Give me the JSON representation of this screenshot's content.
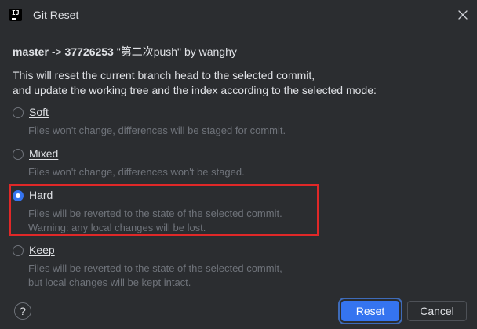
{
  "window": {
    "title": "Git Reset",
    "app_icon": "jetbrains-ide-icon"
  },
  "subject": {
    "branch": "master",
    "arrow": "->",
    "hash": "37726253",
    "message": "\"第二次push\"",
    "by": "by wanghy"
  },
  "description": {
    "line1": "This will reset the current branch head to the selected commit,",
    "line2": "and update the working tree and the index according to the selected mode:"
  },
  "options": [
    {
      "label": "Soft",
      "checked": false,
      "hint1": "Files won't change, differences will be staged for commit.",
      "hint2": ""
    },
    {
      "label": "Mixed",
      "checked": false,
      "hint1": "Files won't change, differences won't be staged.",
      "hint2": ""
    },
    {
      "label": "Hard",
      "checked": true,
      "hint1": "Files will be reverted to the state of the selected commit.",
      "hint2": "Warning: any local changes will be lost."
    },
    {
      "label": "Keep",
      "checked": false,
      "hint1": "Files will be reverted to the state of the selected commit,",
      "hint2": "but local changes will be kept intact."
    }
  ],
  "buttons": {
    "help": "?",
    "reset": "Reset",
    "cancel": "Cancel"
  },
  "colors": {
    "background": "#2b2d30",
    "accent": "#3574f0",
    "highlight_border": "#e02828",
    "hint_text": "#6f737a"
  }
}
